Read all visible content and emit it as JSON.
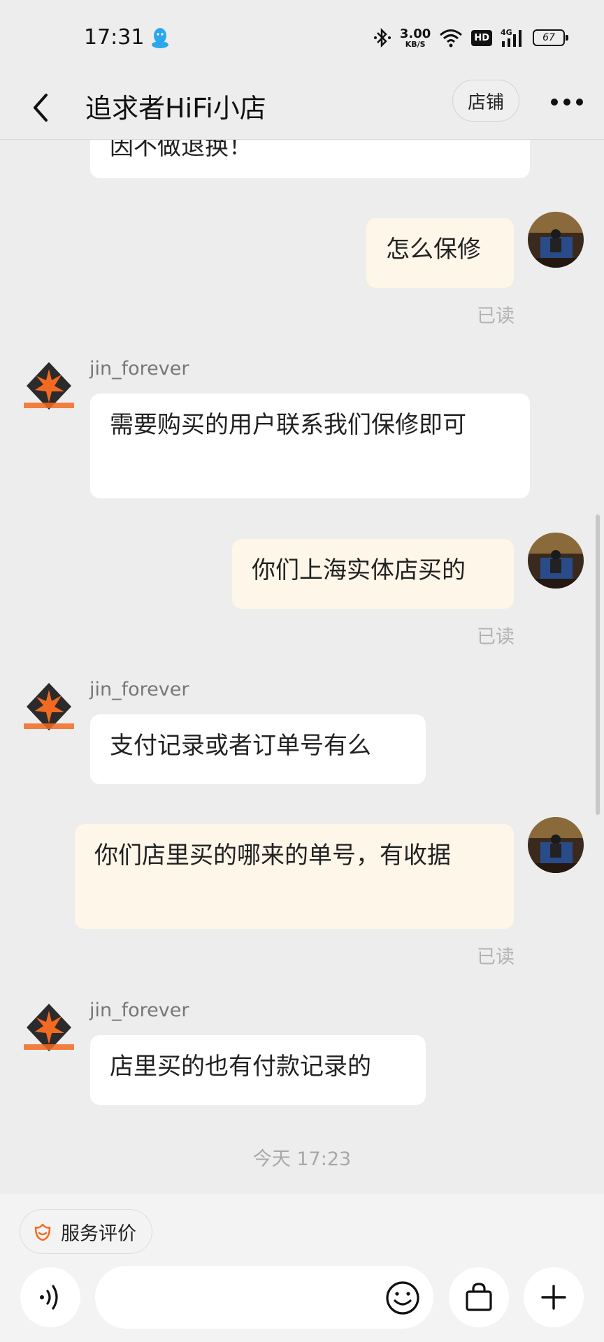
{
  "status_bar": {
    "time": "17:31",
    "net_speed_value": "3.00",
    "net_speed_unit": "KB/S",
    "hd_label": "HD",
    "signal_label": "4G",
    "battery": "67",
    "icons": [
      "qq-icon",
      "bluetooth-icon",
      "wifi-icon",
      "signal-icon",
      "battery-icon"
    ]
  },
  "header": {
    "title": "追求者HiFi小店",
    "shop_button_label": "店铺"
  },
  "chat": {
    "seller_name": "jin_forever",
    "messages": [
      {
        "side": "in",
        "text": "因不做退换！"
      },
      {
        "side": "out",
        "text": "怎么保修",
        "status": "已读"
      },
      {
        "side": "in",
        "sender": "jin_forever",
        "text": "需要购买的用户联系我们保修即可"
      },
      {
        "side": "out",
        "text": "你们上海实体店买的",
        "status": "已读"
      },
      {
        "side": "in",
        "sender": "jin_forever",
        "text": "支付记录或者订单号有么"
      },
      {
        "side": "out",
        "text": "你们店里买的哪来的单号，有收据",
        "status": "已读"
      },
      {
        "side": "in",
        "sender": "jin_forever",
        "text": "店里买的也有付款记录的"
      }
    ],
    "timestamp": "今天  17:23"
  },
  "bottom": {
    "review_label": "服务评价",
    "input_placeholder": ""
  },
  "colors": {
    "background": "#ededed",
    "incoming_bubble": "#ffffff",
    "outgoing_bubble": "#fdf6e9",
    "accent_orange": "#f26a21"
  }
}
